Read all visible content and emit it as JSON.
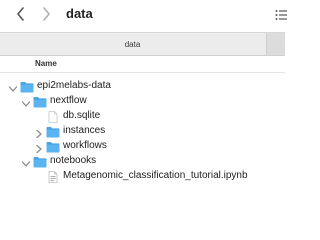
{
  "toolbar": {
    "back_icon": "chevron-left-icon",
    "forward_icon": "chevron-right-icon",
    "title": "data",
    "view_icon": "list-view-icon"
  },
  "tabbar": {
    "active_tab": "data"
  },
  "header": {
    "name": "Name"
  },
  "tree": [
    {
      "label": "epi2melabs-data",
      "kind": "folder",
      "level": 0,
      "expanded": true
    },
    {
      "label": "nextflow",
      "kind": "folder",
      "level": 1,
      "expanded": true
    },
    {
      "label": "db.sqlite",
      "kind": "file",
      "level": 2,
      "expanded": null
    },
    {
      "label": "instances",
      "kind": "folder",
      "level": 2,
      "expanded": false
    },
    {
      "label": "workflows",
      "kind": "folder",
      "level": 2,
      "expanded": false
    },
    {
      "label": "notebooks",
      "kind": "folder",
      "level": 1,
      "expanded": true
    },
    {
      "label": "Metagenomic_classification_tutorial.ipynb",
      "kind": "document",
      "level": 2,
      "expanded": null
    }
  ],
  "colors": {
    "folder": "#5bb4f0",
    "folder_tab": "#4aa3e2",
    "chevron": "#8a8a8a"
  }
}
